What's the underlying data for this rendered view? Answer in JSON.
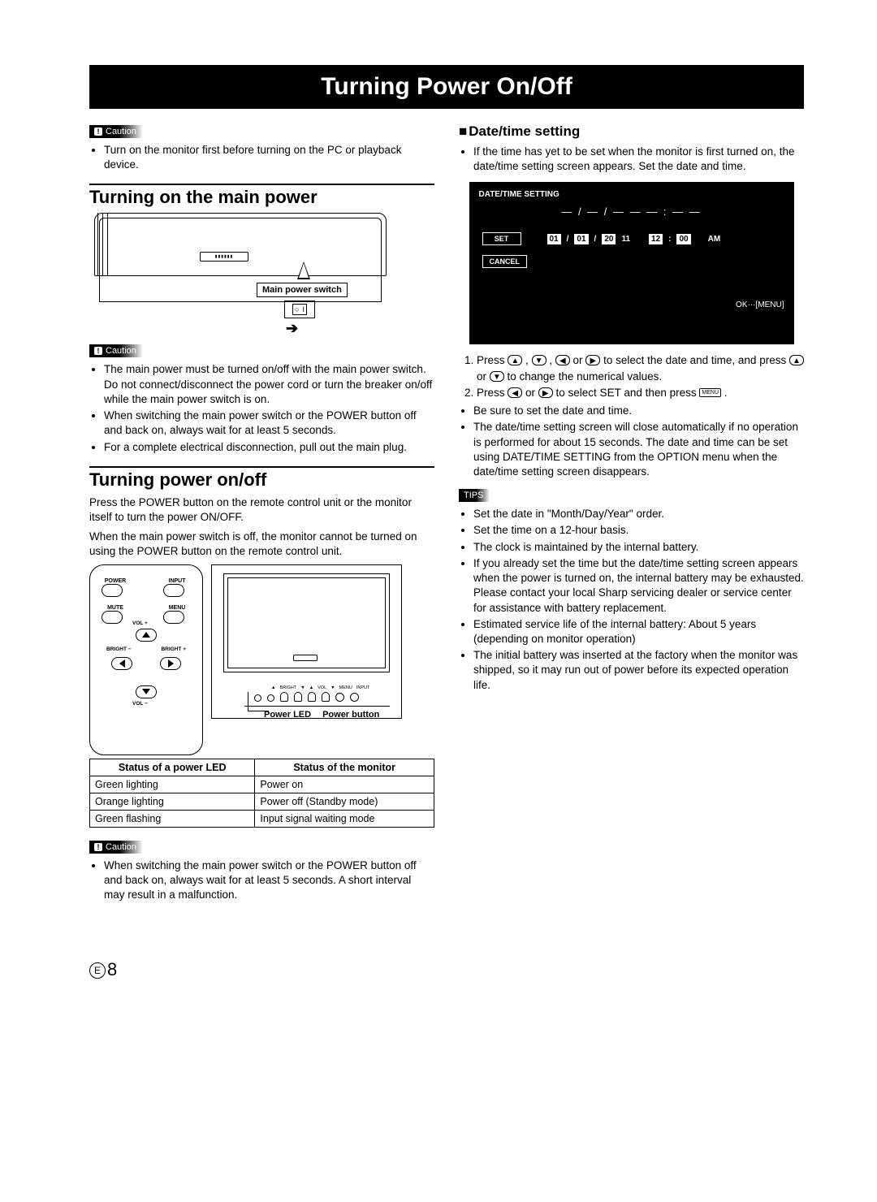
{
  "title": "Turning Power On/Off",
  "page_number": "8",
  "page_marker": "E",
  "left": {
    "caution1_label": "Caution",
    "caution1_items": [
      "Turn on the monitor first before turning on the PC or playback device."
    ],
    "sec1_title": "Turning on the main power",
    "main_power_switch_label": "Main power switch",
    "switch_symbols": "○  I",
    "caution2_label": "Caution",
    "caution2_items": [
      "The main power must be turned on/off with the main power switch. Do not connect/disconnect the power cord or turn the breaker on/off while the main power switch is on.",
      "When switching the main power switch or the POWER button off and back on, always wait for at least 5 seconds.",
      "For a complete electrical disconnection, pull out the main plug."
    ],
    "sec2_title": "Turning power on/off",
    "sec2_body1": "Press the POWER button on the remote control unit or the monitor itself to turn the power ON/OFF.",
    "sec2_body2": "When the main power switch is off, the monitor cannot be turned on using the POWER button on the remote control unit.",
    "remote_labels": {
      "power": "POWER",
      "input": "INPUT",
      "mute": "MUTE",
      "menu": "MENU",
      "vol_plus": "VOL +",
      "vol_minus": "VOL −",
      "bright_minus": "BRIGHT −",
      "bright_plus": "BRIGHT +"
    },
    "monitor_ctrl_labels": [
      "",
      "BRIGHT",
      "VOL",
      "MENU",
      "INPUT"
    ],
    "fig_caption_led": "Power LED",
    "fig_caption_btn": "Power button",
    "status_table": {
      "head": [
        "Status of a power LED",
        "Status of the monitor"
      ],
      "rows": [
        [
          "Green lighting",
          "Power on"
        ],
        [
          "Orange lighting",
          "Power off (Standby mode)"
        ],
        [
          "Green flashing",
          "Input signal waiting mode"
        ]
      ]
    },
    "caution3_label": "Caution",
    "caution3_items": [
      "When switching the main power switch or the POWER button off and back on, always wait for at least 5 seconds. A short interval may result in a malfunction."
    ]
  },
  "right": {
    "subsec_title": "Date/time setting",
    "intro_items": [
      "If the time has yet to be set when the monitor is first turned on, the date/time setting screen appears. Set the date and time."
    ],
    "osd": {
      "title": "DATE/TIME SETTING",
      "dash_row": "— / — / — —    — : — —",
      "set": "SET",
      "cancel": "CANCEL",
      "date": {
        "mm": "01",
        "sep1": "/",
        "dd": "01",
        "sep2": "/",
        "yy_a": "20",
        "yy_b": "11"
      },
      "time": {
        "hh": "12",
        "sep": ":",
        "mm": "00",
        "ampm": "AM"
      },
      "footer": "OK···[MENU]"
    },
    "steps_1_a": "Press ",
    "steps_1_b": " , ",
    "steps_1_c": " , ",
    "steps_1_d": " or ",
    "steps_1_e": " to select the date and time, and press ",
    "steps_1_f": " or ",
    "steps_1_g": " to change the numerical values.",
    "steps_2_a": "Press ",
    "steps_2_b": " or ",
    "steps_2_c": " to select SET and then press ",
    "steps_2_d": " .",
    "after_steps_items": [
      "Be sure to set the date and time.",
      "The date/time setting screen will close automatically if no operation is performed for about 15 seconds. The date and time can be set using DATE/TIME SETTING from the OPTION menu when the date/time setting screen disappears."
    ],
    "tips_label": "TIPS",
    "tips_items": [
      "Set the date in \"Month/Day/Year\" order.",
      "Set the time on a 12-hour basis.",
      "The clock is maintained by the internal battery.",
      "If you already set the time but the date/time setting screen appears when the power is turned on, the internal battery may be exhausted. Please contact your local Sharp servicing dealer or service center for assistance with battery replacement.",
      "Estimated service life of the internal battery: About 5 years (depending on monitor operation)",
      "The initial battery was inserted at the factory when the monitor was shipped, so it may run out of power before its expected operation life."
    ],
    "key_labels": {
      "up": "▲",
      "down": "▼",
      "left": "◀",
      "right": "▶",
      "menu": "MENU"
    }
  }
}
